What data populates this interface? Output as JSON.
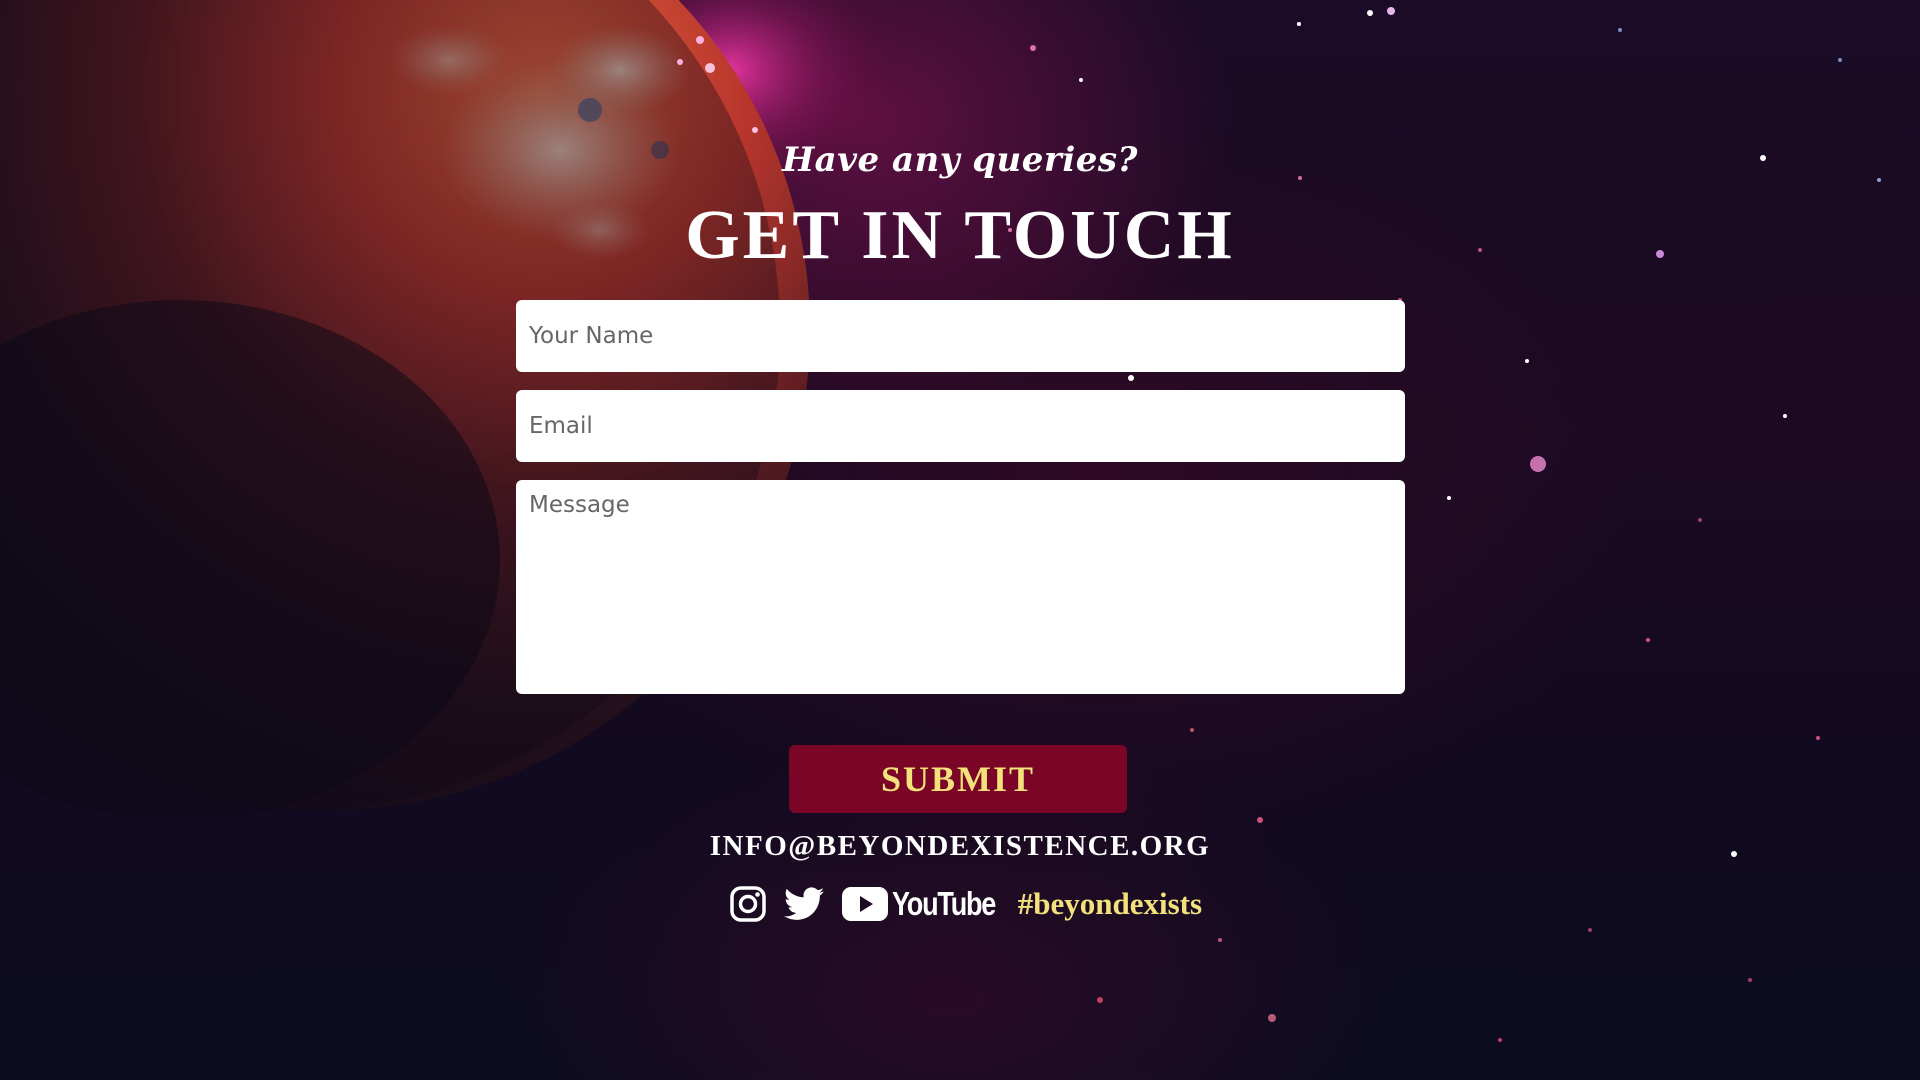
{
  "header": {
    "subtitle": "Have any queries?",
    "title": "GET IN TOUCH"
  },
  "form": {
    "name_placeholder": "Your Name",
    "email_placeholder": "Email",
    "message_placeholder": "Message",
    "submit_label": "SUBMIT"
  },
  "contact": {
    "email": "INFO@BEYONDEXISTENCE.ORG"
  },
  "social": {
    "youtube_label": "YouTube",
    "hashtag": "#beyondexists",
    "icons": [
      "instagram-icon",
      "twitter-icon",
      "youtube-icon"
    ]
  },
  "colors": {
    "submit_bg": "#7a0526",
    "accent_yellow": "#f3e27a",
    "text_white": "#ffffff"
  }
}
